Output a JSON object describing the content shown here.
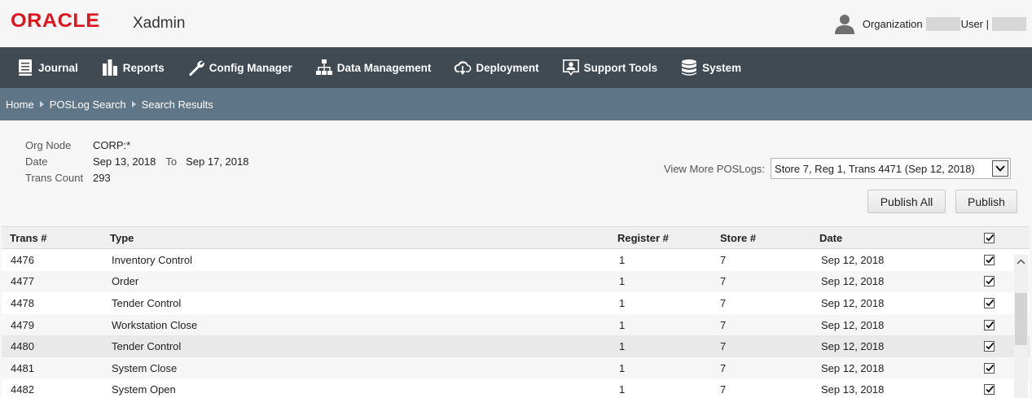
{
  "header": {
    "logo": "ORACLE",
    "app_name": "Xadmin",
    "org_label": "Organization",
    "user_label": "User |"
  },
  "nav": {
    "items": [
      {
        "label": "Journal",
        "icon": "journal-icon"
      },
      {
        "label": "Reports",
        "icon": "bar-chart-icon"
      },
      {
        "label": "Config Manager",
        "icon": "wrench-icon"
      },
      {
        "label": "Data Management",
        "icon": "sitemap-icon"
      },
      {
        "label": "Deployment",
        "icon": "cloud-download-icon"
      },
      {
        "label": "Support Tools",
        "icon": "support-person-icon"
      },
      {
        "label": "System",
        "icon": "database-icon"
      }
    ]
  },
  "breadcrumb": [
    "Home",
    "POSLog Search",
    "Search Results"
  ],
  "criteria": {
    "org_node_label": "Org Node",
    "org_node_value": "CORP:*",
    "date_label": "Date",
    "date_from": "Sep 13, 2018",
    "to_label": "To",
    "date_to": "Sep 17, 2018",
    "trans_count_label": "Trans Count",
    "trans_count_value": "293"
  },
  "view_more": {
    "label": "View More POSLogs:",
    "selected": "Store 7, Reg 1, Trans 4471 (Sep 12, 2018)"
  },
  "buttons": {
    "publish_all": "Publish All",
    "publish": "Publish"
  },
  "table": {
    "headers": {
      "trans": "Trans #",
      "type": "Type",
      "register": "Register #",
      "store": "Store #",
      "date": "Date"
    },
    "rows": [
      {
        "trans": "4476",
        "type": "Inventory Control",
        "register": "1",
        "store": "7",
        "date": "Sep 12, 2018",
        "checked": true
      },
      {
        "trans": "4477",
        "type": "Order",
        "register": "1",
        "store": "7",
        "date": "Sep 12, 2018",
        "checked": true
      },
      {
        "trans": "4478",
        "type": "Tender Control",
        "register": "1",
        "store": "7",
        "date": "Sep 12, 2018",
        "checked": true
      },
      {
        "trans": "4479",
        "type": "Workstation Close",
        "register": "1",
        "store": "7",
        "date": "Sep 12, 2018",
        "checked": true
      },
      {
        "trans": "4480",
        "type": "Tender Control",
        "register": "1",
        "store": "7",
        "date": "Sep 12, 2018",
        "checked": true
      },
      {
        "trans": "4481",
        "type": "System Close",
        "register": "1",
        "store": "7",
        "date": "Sep 12, 2018",
        "checked": true
      },
      {
        "trans": "4482",
        "type": "System Open",
        "register": "1",
        "store": "7",
        "date": "Sep 13, 2018",
        "checked": true
      }
    ]
  },
  "colors": {
    "brand_red": "#e0141d",
    "nav_bg": "#3f4a53",
    "breadcrumb_bg": "#5f7689"
  }
}
